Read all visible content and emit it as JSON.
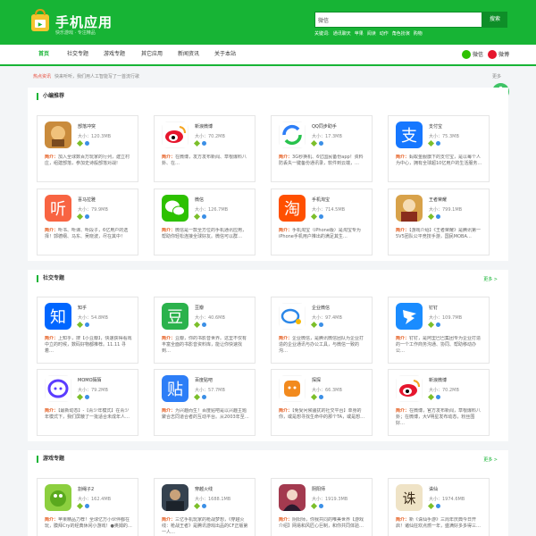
{
  "header": {
    "title": "手机应用",
    "slogan": "快乐游戏 · 专注精品",
    "search_value": "微信",
    "search_button": "搜索",
    "hotwords_label": "关键词:",
    "hotwords": [
      "通讯聊天",
      "苹果",
      "阅读",
      "动作",
      "角色扮演",
      "购物"
    ]
  },
  "nav": {
    "items": [
      "首页",
      "社交专题",
      "游戏专题",
      "其它应用",
      "新闻资讯",
      "关于本站"
    ],
    "active_index": 0,
    "share_wechat": "微信",
    "share_weibo": "微博"
  },
  "hot_news": {
    "label": "热点资讯",
    "text": "快来听听，我们用人工智能写了一首流行歌",
    "more": "更多"
  },
  "colors": {
    "brand": "#17b435",
    "brand_dark": "#0e8e28",
    "intro_label": "#e55a1c"
  },
  "sections": [
    {
      "title": "小编推荐",
      "more": "",
      "apps": [
        {
          "name": "部落冲突",
          "size": "大小：120.3MB",
          "intro": "简介：",
          "desc": "加入全球数百万玩家的行列，建立村庄，组建部落，参加史诗般部落对战!",
          "icon": "game-clash-icon"
        },
        {
          "name": "新浪微博",
          "size": "大小：70.2MB",
          "intro": "简介：",
          "desc": "在微博，发方发布新闻、草根爆料八卦、在…",
          "icon": "weibo-icon"
        },
        {
          "name": "QQ同步助手",
          "size": "大小：17.3MB",
          "intro": "简介：",
          "desc": "3G秒换机、6亿国民备份app！资料防丢失一键备份通讯录，软件到云端，…",
          "icon": "qq-sync-icon"
        },
        {
          "name": "支付宝",
          "size": "大小：75.3MB",
          "intro": "简介：",
          "desc": "蚂蚁金服旗下的支付宝，是以每个人为中心，拥有全球超10亿用户的生活服务…",
          "icon": "alipay-icon"
        },
        {
          "name": "喜马拉雅",
          "size": "大小：79.9MB",
          "intro": "简介：",
          "desc": "听书、听课、听段子，6亿用户的选择！郭德纲、马东、吴晓波，尽在其中！",
          "icon": "ximalaya-icon"
        },
        {
          "name": "微信",
          "size": "大小：126.7MB",
          "intro": "简介：",
          "desc": "微信是一款全方位的手机通讯应用，帮助你轻松连接全球好友。微信可以群…",
          "icon": "wechat-icon"
        },
        {
          "name": "手机淘宝",
          "size": "大小：714.5MB",
          "intro": "简介：",
          "desc": "手机淘宝（iPhone版）是淘宝专为iPhone手机用户推出的满足其生…",
          "icon": "taobao-icon"
        },
        {
          "name": "王者荣耀",
          "size": "大小：799.1MB",
          "intro": "简介：",
          "desc": "【游戏介绍】《王者荣耀》是腾讯第一5V5团队公平竞技手游，国民MOBA…",
          "icon": "game-kings-icon"
        }
      ]
    },
    {
      "title": "社交专题",
      "more": "更多 >",
      "apps": [
        {
          "name": "知乎",
          "size": "大小：54.8MB",
          "intro": "简介：",
          "desc": "上知乎，搜【小豆瓣】，快速获得看戏中立的时候，数码好物都推荐。11.11 寻着…",
          "icon": "zhihu-icon"
        },
        {
          "name": "豆瓣",
          "size": "大小：40.6MB",
          "intro": "简介：",
          "desc": "豆瓣，你的书影音世界。这里不仅有丰富全面的书影音资料库，能让你快速找到…",
          "icon": "douban-icon"
        },
        {
          "name": "企业微信",
          "size": "大小：97.4MB",
          "intro": "简介：",
          "desc": "企业微信，是腾讯微信团队为企业打造的企业通讯与办公工具，与微信一致的沟…",
          "icon": "wework-icon"
        },
        {
          "name": "钉钉",
          "size": "大小：109.7MB",
          "intro": "简介：",
          "desc": "钉钉，是阿里巴巴集团专为企业打造的一个工作商务沟通、协同、帮助移动办公…",
          "icon": "dingtalk-icon"
        },
        {
          "name": "MOMO陌陌",
          "size": "大小：79.2MB",
          "intro": "简介：",
          "desc": "【最新动态】-【青少年模式】在青少年模式下，我们屏蔽了一批适合未成年人…",
          "icon": "momo-icon"
        },
        {
          "name": "百度贴吧",
          "size": "大小：57.7MB",
          "intro": "简介：",
          "desc": "为兴趣而生！百度贴吧是以兴趣主题聚合志同道合者的互动平台。从2003年至…",
          "icon": "tieba-icon"
        },
        {
          "name": "探探",
          "size": "大小：66.3MB",
          "intro": "简介：",
          "desc": "【免受问候骚扰的社交平台】单身的你，或是想寻找生命中的那个TA，或是想…",
          "icon": "tantan-icon"
        },
        {
          "name": "新浪微博",
          "size": "大小：70.2MB",
          "intro": "简介：",
          "desc": "在微博，官方发布新闻，草根爆料八卦；在微博，大V明星发布动态，粉丝围好…",
          "icon": "weibo-icon"
        }
      ]
    },
    {
      "title": "游戏专题",
      "more": "更多 >",
      "apps": [
        {
          "name": "割绳子2",
          "size": "大小：162.4MB",
          "intro": "简介：",
          "desc": "苹果精品力荐！全球亿万小伙伴都在玩，膜拜Cry的经典休闲小游戏！●奥姆的…",
          "icon": "game-rope-icon"
        },
        {
          "name": "穿越火线",
          "size": "大小：1688.1MB",
          "intro": "简介：",
          "desc": "三亿手机玩家的枪战梦想，《穿越火线：枪战王者》是腾讯游戏出品的CF正版第一人…",
          "icon": "game-cf-icon"
        },
        {
          "name": "阴阳师",
          "size": "大小：1919.3MB",
          "intro": "简介：",
          "desc": "阴阳师，你我共同的唯美世界【游戏介绍】网易和风匠心巨制，和你共同体验…",
          "icon": "game-onmyoji-icon"
        },
        {
          "name": "诛仙",
          "size": "大小：1974.6MB",
          "intro": "简介：",
          "desc": "新《诛仙手游》三周年庆典今日开启！诸仙狂欢点燃一年，盛满好多多得三…",
          "icon": "game-zhuxian-icon"
        }
      ]
    }
  ]
}
